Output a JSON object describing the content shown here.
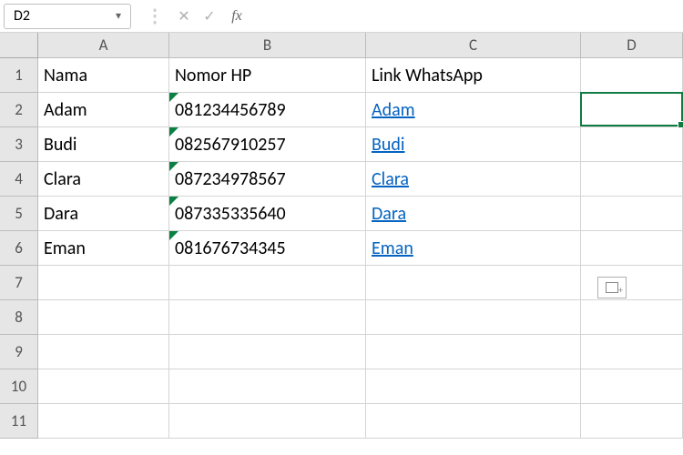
{
  "name_box": "D2",
  "formula": "",
  "columns": [
    "A",
    "B",
    "C",
    "D"
  ],
  "row_numbers": [
    "1",
    "2",
    "3",
    "4",
    "5",
    "6",
    "7",
    "8",
    "9",
    "10",
    "11"
  ],
  "headers": {
    "a": "Nama",
    "b": "Nomor HP",
    "c": "Link WhatsApp"
  },
  "rows": [
    {
      "a": "Adam",
      "b": "081234456789",
      "c": "Adam"
    },
    {
      "a": "Budi",
      "b": "082567910257",
      "c": "Budi"
    },
    {
      "a": "Clara",
      "b": "087234978567",
      "c": "Clara"
    },
    {
      "a": "Dara",
      "b": "087335335640",
      "c": "Dara"
    },
    {
      "a": "Eman",
      "b": "081676734345",
      "c": "Eman"
    }
  ],
  "active_cell_ref": "D2"
}
